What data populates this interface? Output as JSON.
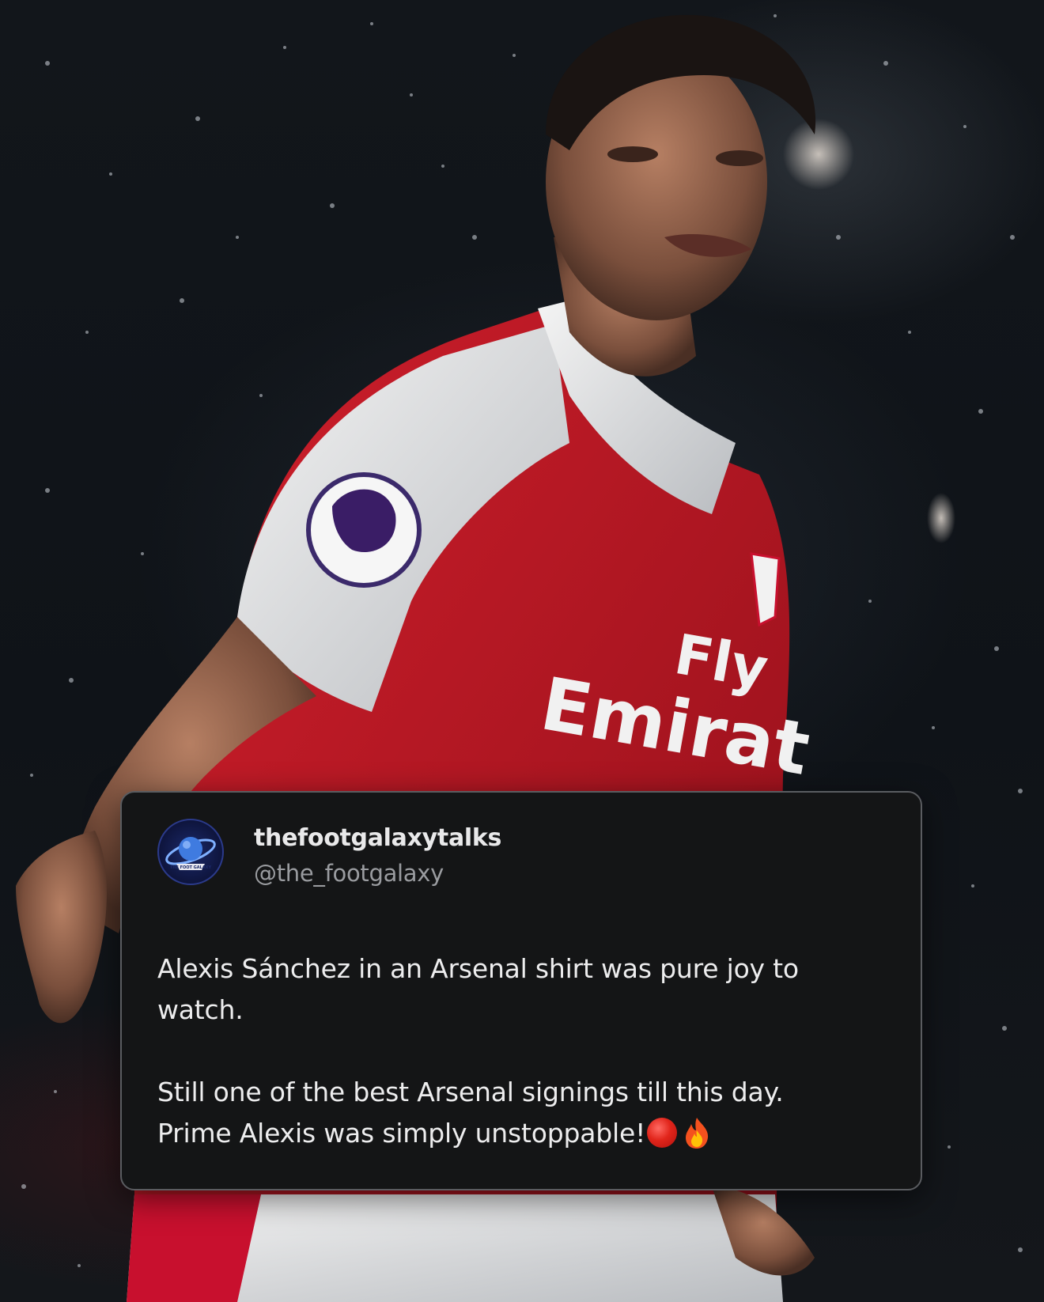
{
  "post": {
    "author": {
      "display_name": "thefootgalaxytalks",
      "handle": "@the_footgalaxy",
      "avatar_icon": "foot-galaxy-logo-icon",
      "avatar_logo_text": "THE FOOT GALAXY"
    },
    "body": {
      "paragraph1_line1": "Alexis Sánchez in an Arsenal shirt was pure joy to",
      "paragraph1_line2": "watch.",
      "paragraph2_line1": "Still one of the best Arsenal signings till this day.",
      "paragraph2_line2": "Prime Alexis was simply unstoppable!",
      "emojis": [
        "red-circle-icon",
        "fire-icon"
      ]
    }
  },
  "photo": {
    "subject": "footballer-celebrating-in-rain",
    "shirt_sponsor_text": "Fly Emirates",
    "sleeve_badge_text": "Premier League",
    "colors": {
      "shirt_red": "#c8102e",
      "shirt_white": "#f2f2f2",
      "background": "#0f1318"
    }
  }
}
